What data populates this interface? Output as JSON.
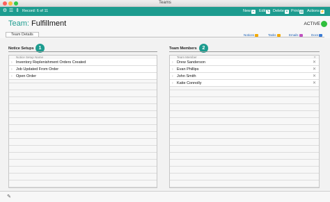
{
  "window": {
    "title": "Teams"
  },
  "toolbar": {
    "record": "Record: 6 of 11",
    "buttons": {
      "new": "New",
      "edit": "Edit",
      "delete": "Delete",
      "print": "Print",
      "actions": "Actions"
    },
    "icons": {
      "gear": "gear-icon",
      "list": "list-icon",
      "sort": "sort-icon"
    },
    "accent_color": "#1d9c8f"
  },
  "header": {
    "team_key": "Team:",
    "team_name": "Fulfillment",
    "status": "ACTIVE",
    "status_color": "#2fbf3d"
  },
  "tabs": [
    {
      "label": "Team Details"
    }
  ],
  "links": {
    "notices": "Notices",
    "tasks": "Tasks",
    "emails": "Emails",
    "docs": "Docs"
  },
  "notice_setups": {
    "title": "Notice Setups",
    "badge": "1",
    "column": "Notice Setup Name",
    "rows": [
      "Inventory Replenishment Orders Created",
      "Job Updated From Order",
      "Open Order"
    ]
  },
  "team_members": {
    "title": "Team Members",
    "badge": "2",
    "column": "Team Member",
    "rows": [
      "Drew Sanderson",
      "Evan Phillips",
      "John Smith",
      "Katie Connolly"
    ]
  }
}
